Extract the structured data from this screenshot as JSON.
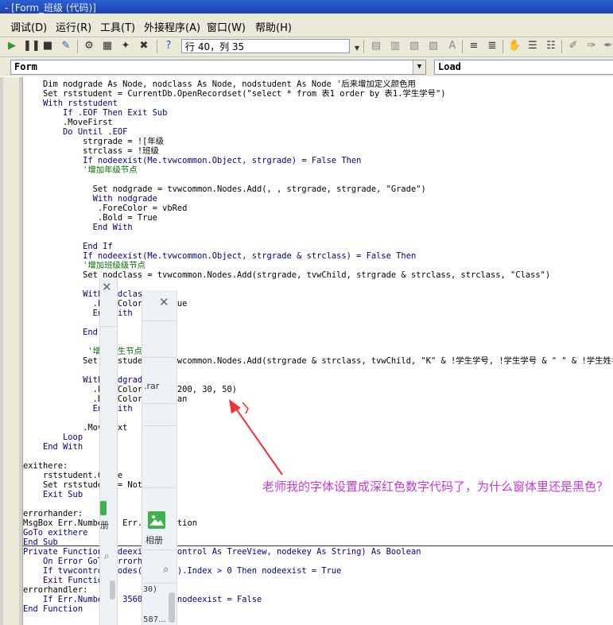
{
  "window": {
    "title": "- [Form_班级 (代码)]"
  },
  "menu": [
    "调试(D)",
    "运行(R)",
    "工具(T)",
    "外接程序(A)",
    "窗口(W)",
    "帮助(H)"
  ],
  "toolbar": {
    "cursor_position": "行 40，列 35"
  },
  "object_combo": {
    "value": "Form"
  },
  "procedure_combo": {
    "value": "Load"
  },
  "code_lines": [
    "    Dim nodgrade As Node, nodclass As Node, nodstudent As Node '后来增加定义颜色用",
    "    Set rststudent = CurrentDb.OpenRecordset(\"select * from 表1 order by 表1.学生学号\")",
    "    With rststudent",
    "        If .EOF Then Exit Sub",
    "        .MoveFirst",
    "        Do Until .EOF",
    "            strgrade = ![年级",
    "            strclass = !班级",
    "            If nodeexist(Me.tvwcommon.Object, strgrade) = False Then",
    "            '增加年级节点",
    "",
    "              Set nodgrade = tvwcommon.Nodes.Add(, , strgrade, strgrade, \"Grade\")",
    "              With nodgrade",
    "               .ForeColor = vbRed",
    "               .Bold = True",
    "              End With",
    "",
    "            End If",
    "            If nodeexist(Me.tvwcommon.Object, strgrade & strclass) = False Then",
    "            '增加班级级节点",
    "            Set nodclass = tvwcommon.Nodes.Add(strgrade, tvwChild, strgrade & strclass, strclass, \"Class\")",
    "",
    "            With nodclass",
    "              .ForeColor = vbBlue",
    "              End With",
    "",
    "            End If",
    "",
    "             '增加学生节点",
    "            Set nodstudent = tvwcommon.Nodes.Add(strgrade & strclass, tvwChild, \"K\" & !学生学号, !学生学号 & \" \" & !学生姓名",
    "",
    "            With nodgrade",
    "              .ForeColor = RGB(200, 30, 50)",
    "              .BackColor = vbCyan",
    "              End With",
    "",
    "            .MoveNext",
    "        Loop",
    "    End With",
    "",
    "exithere:",
    "    rststudent.Close",
    "    Set rststudent = Nothing",
    "    Exit Sub",
    "",
    "errorhander:",
    "MsgBox Err.Number & Err.Description",
    "GoTo exithere",
    "End Sub",
    "Private Function nodeexist(tvwcontrol As TreeView, nodekey As String) As Boolean",
    "    On Error GoTo errorhandler:",
    "    If tvwcontrol.Nodes(nodekey).Index > 0 Then nodeexist = True",
    "    Exit Function",
    "errorhandler:",
    "    If Err.Number = 35601 Then nodeexist = False",
    "End Function"
  ],
  "annotation": "老师我的字体设置成深红色数字代码了，为什么窗体里还是黑色？",
  "overlay_panel_right": {
    "rar_text": ".rar",
    "album_label": "相册",
    "number_text": "30)",
    "bottom_text": "587..."
  },
  "overlay_panel_left": {
    "album_label": "册"
  },
  "colors": {
    "annotation": "#c33ad1",
    "arrow": "#ee3333",
    "keyword": "#00007f",
    "comment": "#007000"
  }
}
